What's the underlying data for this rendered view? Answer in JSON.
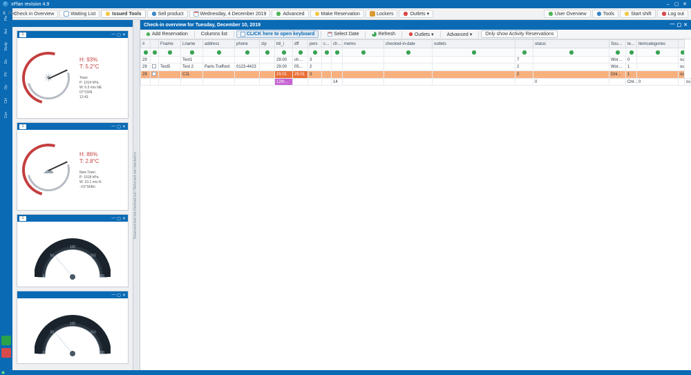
{
  "window": {
    "title": "xPlan revision 4.9"
  },
  "ribbon": {
    "left": [
      {
        "icon": "ico-user",
        "label": "Check in Overview"
      },
      {
        "icon": "ico-list",
        "label": "Waiting List"
      },
      {
        "icon": "ico-dot-y",
        "label": "Issued Tools",
        "active": true
      },
      {
        "icon": "ico-gear",
        "label": "Sell product"
      },
      {
        "icon": "ico-cal",
        "label": "Wednesday, 4 December 2019"
      },
      {
        "icon": "ico-dot-g",
        "label": "Advanced"
      },
      {
        "icon": "ico-dot-y",
        "label": "Make Reservation"
      },
      {
        "icon": "ico-lock",
        "label": "Lockers"
      },
      {
        "icon": "ico-dot-r",
        "label": "Outlets ▾"
      }
    ],
    "right": [
      {
        "icon": "ico-dot-g",
        "label": "User Overview"
      },
      {
        "icon": "ico-gear",
        "label": "Tools"
      },
      {
        "icon": "ico-dot-y",
        "label": "Start shift"
      },
      {
        "icon": "ico-dot-r",
        "label": "Log out"
      }
    ]
  },
  "logo_text": "Plan",
  "rail": {
    "items": [
      "Plan",
      "Act",
      "Study",
      "Do",
      "PV",
      "Op",
      "Ctrl",
      "Con"
    ]
  },
  "gauges": [
    {
      "num": "1",
      "humidity": "H: 93%",
      "temp": "T: 5.2°C",
      "loc": "Town",
      "lines": [
        "P: 1014 hPa",
        "W: 6.5 m/s NE",
        "07°CRN",
        "12:43"
      ],
      "icon": "☀"
    },
    {
      "num": "1",
      "humidity": "H: 86%",
      "temp": "T: 2.8°C",
      "loc": "New Town",
      "lines": [
        "P: 1018 hPa",
        "W: 10.1 m/s N",
        "−01°ShRn"
      ],
      "icon": "☁"
    }
  ],
  "dark_gauges": [
    {
      "num": "1",
      "ticks": [
        "0",
        "50",
        "100",
        "150",
        "200"
      ]
    },
    {
      "num": "",
      "ticks": [
        "0",
        "50",
        "100",
        "150",
        "200"
      ]
    }
  ],
  "panel": {
    "title": "Check-in overview for Tuesday, December 10, 2019",
    "toolbar": [
      {
        "label": "Add Reservation",
        "on": false,
        "icon": "ico-dot-g"
      },
      {
        "label": "Columns list",
        "on": false,
        "icon": ""
      },
      {
        "label": "CLICK here to open keyboard",
        "on": false,
        "cta": true,
        "icon": "ico-list"
      },
      {
        "label": "Select Date",
        "on": false,
        "icon": "ico-cal"
      },
      {
        "label": "Refresh",
        "on": false,
        "icon": "ico-refresh"
      },
      {
        "label": "Outlets ▾",
        "on": false,
        "icon": "ico-dot-r"
      },
      {
        "label": "Advanced ▾",
        "on": false,
        "icon": ""
      },
      {
        "label": "Only show Activity Reservations",
        "on": true,
        "icon": ""
      }
    ],
    "columns": [
      "#",
      "",
      "Fname",
      "Lname",
      "address",
      "phone",
      "zip",
      "btl_i",
      "dff",
      "pers",
      "c…",
      "ch…",
      "memo",
      "checked-in-date",
      "outlets",
      "",
      "status",
      "Sou…",
      "te…",
      "itemcategories",
      ""
    ],
    "rows": [
      {
        "cells": [
          "",
          "",
          "",
          "",
          "",
          "",
          "",
          "",
          "",
          "",
          "",
          "",
          "",
          "",
          "",
          "",
          "",
          "",
          "",
          "",
          ""
        ],
        "filter": true
      },
      {
        "cells": [
          "29",
          "",
          "",
          "Test1",
          "",
          "",
          "",
          "29.00",
          "ch…",
          "3",
          "",
          "",
          "",
          "",
          "",
          "7",
          "",
          "Wor…",
          "0",
          "",
          "outa"
        ]
      },
      {
        "cells": [
          "29",
          "1",
          "Test5",
          "Test 2",
          "Paris-Trafford",
          "0123-4423",
          "",
          "29.00",
          "05…",
          "2",
          "",
          "",
          "",
          "",
          "",
          "2",
          "",
          "Wor…",
          "1",
          "",
          "outa"
        ]
      },
      {
        "cells": [
          "29",
          "…",
          "",
          "CJL",
          "",
          "",
          "",
          "29.01",
          "29.01",
          "3",
          "",
          "",
          "",
          "",
          "",
          "2",
          "",
          "Onl…",
          "1",
          "",
          "outa"
        ],
        "orange": true
      },
      {
        "cells": [
          "",
          "",
          "",
          "",
          "",
          "",
          "",
          "12th…",
          "",
          "",
          "",
          "14",
          "",
          "",
          "",
          "",
          "0",
          "",
          "Onl…",
          "0",
          "",
          "outa"
        ],
        "last": true
      }
    ]
  }
}
